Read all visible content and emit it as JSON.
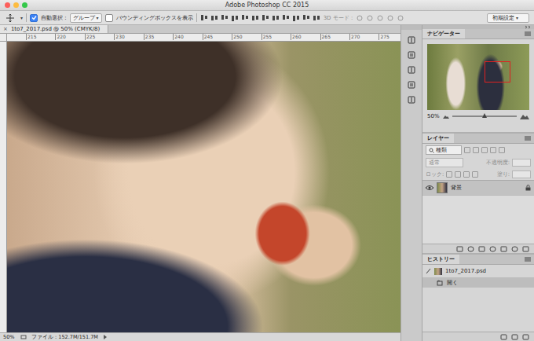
{
  "window": {
    "title": "Adobe Photoshop CC 2015"
  },
  "options_bar": {
    "auto_select": {
      "label": "自動選択 :",
      "checked": true
    },
    "target": "グループ",
    "bounding_box": {
      "label": "バウンディングボックスを表示",
      "checked": false
    },
    "mode_label": "3D モード :",
    "mode_disabled": true,
    "workspace": "初期設定"
  },
  "document": {
    "tab_title": "1to7_2017.psd @ 50% (CMYK/8)",
    "close": "×",
    "ruler_ticks": [
      "215",
      "220",
      "225",
      "230",
      "235",
      "240",
      "245",
      "250",
      "255",
      "260",
      "265",
      "270",
      "275"
    ],
    "zoom": "50%",
    "file_info": "ファイル : 152.7M/151.7M"
  },
  "navigator": {
    "title": "ナビゲーター",
    "zoom": "50%",
    "level": 0.5
  },
  "layers": {
    "title": "レイヤー",
    "filter_placeholder": "種類",
    "blend_mode": "通常",
    "opacity_label": "不透明度:",
    "lock_label": "ロック:",
    "fill_label": "塗り:",
    "controls_disabled": true,
    "items": [
      {
        "name": "背景",
        "visible": true,
        "locked": true,
        "selected": true
      }
    ]
  },
  "history": {
    "title": "ヒストリー",
    "snapshot": "1to7_2017.psd",
    "items": [
      {
        "name": "開く",
        "selected": true
      }
    ]
  }
}
